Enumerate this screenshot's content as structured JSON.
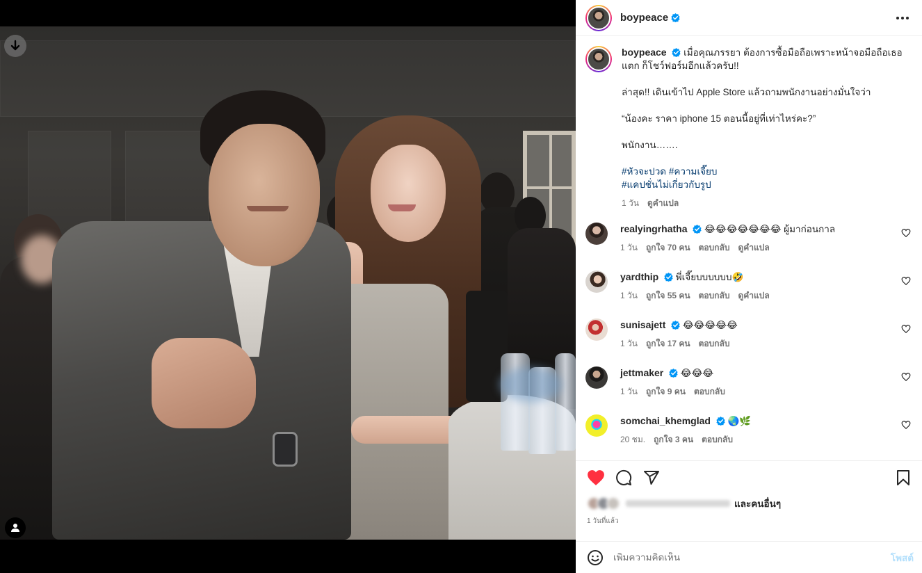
{
  "colors": {
    "like_red": "#ff3040",
    "verified_blue": "#0095f6",
    "post_disabled": "#b2dffc",
    "hashtag": "#00376b"
  },
  "header": {
    "username": "boypeace",
    "more_icon": "more-horizontal-icon"
  },
  "caption": {
    "username": "boypeace",
    "paragraphs": [
      "เมื่อคุณภรรยา ต้องการซื้อมือถือเพราะหน้าจอมือถือเธอแตก ก็โชว์ฟอร์มอีกแล้วครับ!!",
      "ล่าสุด!! เดินเข้าไป Apple Store แล้วถามพนักงานอย่างมั่นใจว่า",
      "“น้องคะ ราคา iphone 15 ตอนนี้อยู่ที่เท่าไหร่คะ?”",
      "พนักงาน……."
    ],
    "hashtags": [
      "#หัวจะปวด",
      "#ความเจี๊ยบ",
      "#แคปชั่นไม่เกี่ยวกับรูป"
    ],
    "time": "1 วัน",
    "translate": "ดูคำแปล"
  },
  "comments": [
    {
      "username": "realyingrhatha",
      "text": "😂😂😂😂😂😂😂 ผู้มาก่อนกาล",
      "time": "1 วัน",
      "likes": "ถูกใจ 70 คน",
      "reply": "ตอบกลับ",
      "translate": "ดูคำแปล"
    },
    {
      "username": "yardthip",
      "text": "พี่เจี๊ยบบบบบบ🤣",
      "time": "1 วัน",
      "likes": "ถูกใจ 55 คน",
      "reply": "ตอบกลับ",
      "translate": "ดูคำแปล"
    },
    {
      "username": "sunisajett",
      "text": "😂😂😂😂😂",
      "time": "1 วัน",
      "likes": "ถูกใจ 17 คน",
      "reply": "ตอบกลับ"
    },
    {
      "username": "jettmaker",
      "text": "😂😂😂",
      "time": "1 วัน",
      "likes": "ถูกใจ 9 คน",
      "reply": "ตอบกลับ"
    },
    {
      "username": "somchai_khemglad",
      "text": "🌏🌿",
      "time": "20 ชม.",
      "likes": "ถูกใจ 3 คน",
      "reply": "ตอบกลับ"
    }
  ],
  "likes_line": {
    "tail": "และคนอื่นๆ"
  },
  "timestamp": "1 วันที่แล้ว",
  "add_comment": {
    "placeholder": "เพิ่มความคิดเห็น",
    "post_label": "โพสต์"
  },
  "actions": {
    "like_icon": "heart-filled-icon",
    "comment_icon": "comment-icon",
    "share_icon": "share-icon",
    "save_icon": "bookmark-icon"
  }
}
